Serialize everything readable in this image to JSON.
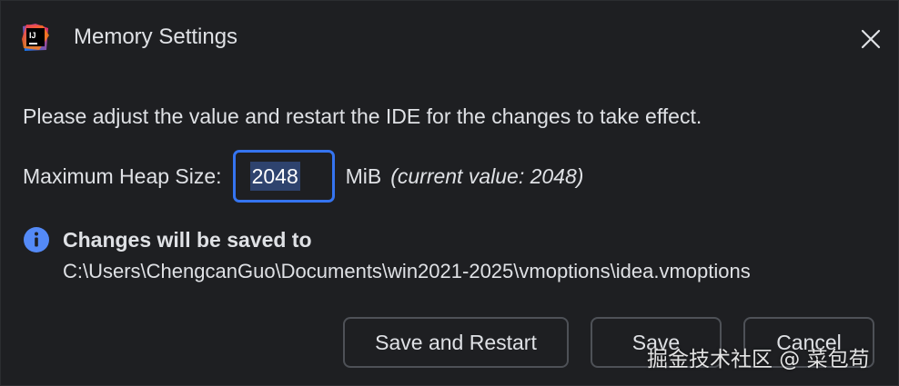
{
  "window": {
    "title": "Memory Settings",
    "logo_text": "IJ"
  },
  "message": "Please adjust the value and restart the IDE for the changes to take effect.",
  "heap": {
    "label": "Maximum Heap Size:",
    "value": "2048",
    "unit": "MiB",
    "current": "(current value: 2048)"
  },
  "notice": {
    "title": "Changes will be saved to",
    "path": "C:\\Users\\ChengcanGuo\\Documents\\win2021-2025\\vmoptions\\idea.vmoptions"
  },
  "buttons": {
    "save_restart": "Save and Restart",
    "save": "Save",
    "cancel": "Cancel"
  },
  "watermark": "掘金技术社区 @ 菜包苟",
  "colors": {
    "background": "#1e1f22",
    "focus_border": "#3574f0",
    "info_icon": "#548af7",
    "button_border": "#4e5157"
  },
  "icons": {
    "logo": "intellij-idea-icon",
    "close": "close-icon",
    "info": "info-icon"
  }
}
